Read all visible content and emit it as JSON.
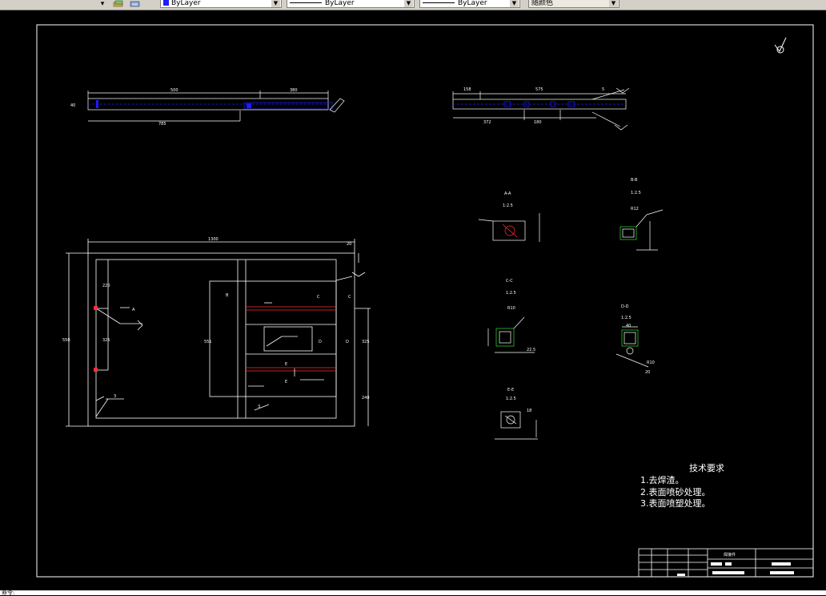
{
  "toolbar": {
    "arrow_glyph": "▾",
    "layer_linetype_combo": "ByLayer",
    "linetype_combo": "ByLayer",
    "lineweight_combo": "ByLayer",
    "plotstyle_combo": "随颜色",
    "color_accent": "#1c1cff"
  },
  "drawing": {
    "background": "#000000",
    "frame_color": "#ffffff",
    "surface_symbol": "√",
    "front_view": {
      "dim_500": "500",
      "dim_380": "380",
      "dim_785": "785",
      "dim_height": "40"
    },
    "side_view": {
      "dim_158": "158",
      "dim_575": "575",
      "dim_372": "372",
      "dim_180": "180",
      "weld_note": "5"
    },
    "plan_view": {
      "dim_1300": "1300",
      "dim_20": "20",
      "dim_overall_h": "550",
      "dim_left_1": "220",
      "dim_left_2": "325",
      "dim_inner_w": "551",
      "dim_inner_h": "325",
      "dim_right": "240",
      "label_A": "A",
      "label_B": "B",
      "label_C": "C",
      "label_D": "D",
      "label_E": "E",
      "weld_3": "3"
    },
    "sections": {
      "aa_title": "A-A",
      "aa_scale": "1:2.5",
      "bb_title": "B-B",
      "bb_scale": "1:2.5",
      "cc_title": "C-C",
      "cc_scale": "1:2.5",
      "dd_title": "D-D",
      "dd_scale": "1:2.5",
      "ee_title": "E-E",
      "ee_scale": "1:2.5",
      "r10": "R10",
      "r12": "R12",
      "d40": "40",
      "d22": "22.5",
      "d18": "18",
      "d20": "20"
    },
    "tech": {
      "title": "技术要求",
      "items": [
        "1.去焊渣。",
        "2.表面喷砂处理。",
        "3.表面喷塑处理。"
      ]
    },
    "title_block": {
      "part_name": "焊接件"
    }
  },
  "cmdline": {
    "text": "命令:"
  }
}
